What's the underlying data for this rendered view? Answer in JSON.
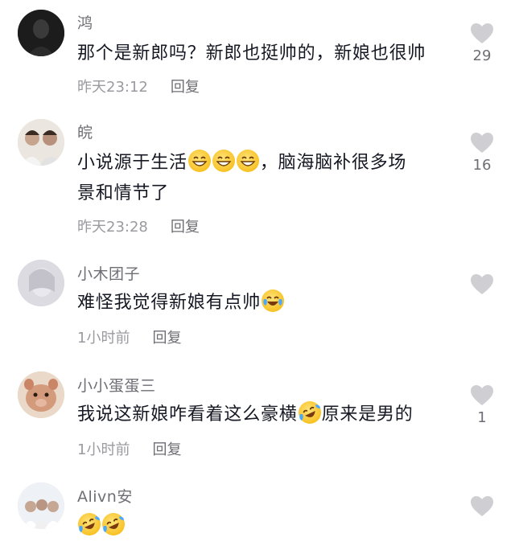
{
  "comments": [
    {
      "username": "鸿",
      "text_parts": [
        "那个是新郎吗？新郎也挺帅的，新娘也很帅"
      ],
      "time": "昨天23:12",
      "reply_label": "回复",
      "likes": "29",
      "avatar_color": "#1c1c1c"
    },
    {
      "username": "皖",
      "text_parts": [
        "小说源于生活",
        "，脑海脑补很多场",
        "景和情节了"
      ],
      "emojis": [
        "grin-emoji",
        "grin-emoji",
        "grin-emoji"
      ],
      "time": "昨天23:28",
      "reply_label": "回复",
      "likes": "16",
      "avatar_color": "#c9b6a6"
    },
    {
      "username": "小木团子",
      "text_parts": [
        "难怪我觉得新娘有点帅"
      ],
      "emojis": [
        "laugh-cry-emoji"
      ],
      "time": "1小时前",
      "reply_label": "回复",
      "likes": "",
      "avatar_color": "#d8d6dc"
    },
    {
      "username": "小小蛋蛋三",
      "text_parts": [
        "我说这新娘咋看着这么豪横",
        "原来是男的"
      ],
      "emojis": [
        "rolling-laugh-emoji"
      ],
      "time": "1小时前",
      "reply_label": "回复",
      "likes": "1",
      "avatar_color": "#c98f72"
    },
    {
      "username": "Alivn安",
      "text_parts": [],
      "emojis": [
        "rolling-laugh-emoji",
        "rolling-laugh-emoji"
      ],
      "time": "",
      "reply_label": "",
      "likes": "",
      "avatar_color": "#e4e8ee"
    }
  ]
}
